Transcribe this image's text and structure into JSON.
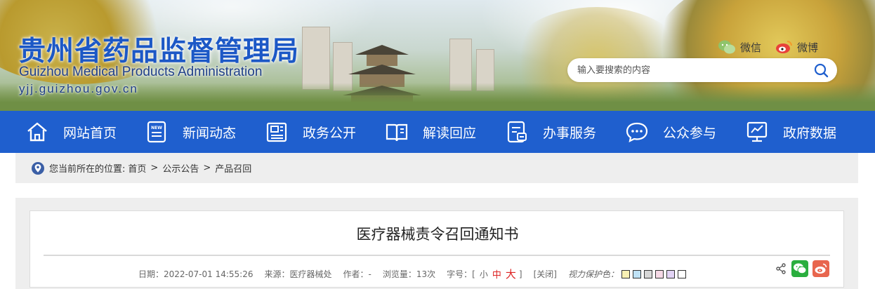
{
  "header": {
    "title": "贵州省药品监督管理局",
    "title_en": "Guizhou Medical Products Administration",
    "url": "yjj.guizhou.gov.cn",
    "social": [
      {
        "label": "微信",
        "icon": "wechat-icon"
      },
      {
        "label": "微博",
        "icon": "weibo-icon"
      }
    ],
    "search": {
      "placeholder": "输入要搜索的内容",
      "icon": "search-icon"
    }
  },
  "nav": {
    "items": [
      {
        "label": "网站首页",
        "icon": "home-icon"
      },
      {
        "label": "新闻动态",
        "icon": "news-icon"
      },
      {
        "label": "政务公开",
        "icon": "document-icon"
      },
      {
        "label": "解读回应",
        "icon": "book-icon"
      },
      {
        "label": "办事服务",
        "icon": "service-icon"
      },
      {
        "label": "公众参与",
        "icon": "chat-icon"
      },
      {
        "label": "政府数据",
        "icon": "data-icon"
      }
    ]
  },
  "breadcrumb": {
    "prefix": "您当前所在的位置:",
    "items": [
      "首页",
      "公示公告",
      "产品召回"
    ],
    "icon": "location-pin-icon"
  },
  "article": {
    "title": "医疗器械责令召回通知书",
    "date_label": "日期：",
    "date": "2022-07-01 14:55:26",
    "source_label": "来源：",
    "source": "医疗器械处",
    "author_label": "作者：",
    "author": "-",
    "views_label": "浏览量：",
    "views": "13次",
    "font_label": "字号：[",
    "font_small": "小",
    "font_mid": "中",
    "font_large": "大",
    "font_close": "]",
    "close_label": "[关闭]",
    "eye_label": "视力保护色：",
    "eye_colors": [
      "#f8f0b4",
      "#bfe2f6",
      "#d7d7d7",
      "#f6d9e6",
      "#e2d3f5",
      "#ffffff"
    ],
    "share_icons": [
      "share-icon",
      "wechat-share-icon",
      "weibo-share-icon"
    ]
  },
  "colors": {
    "brand_blue": "#1f5fce",
    "title_blue": "#1c58c6",
    "wechat_green": "#2aae3e",
    "weibo_red": "#e8664e"
  }
}
